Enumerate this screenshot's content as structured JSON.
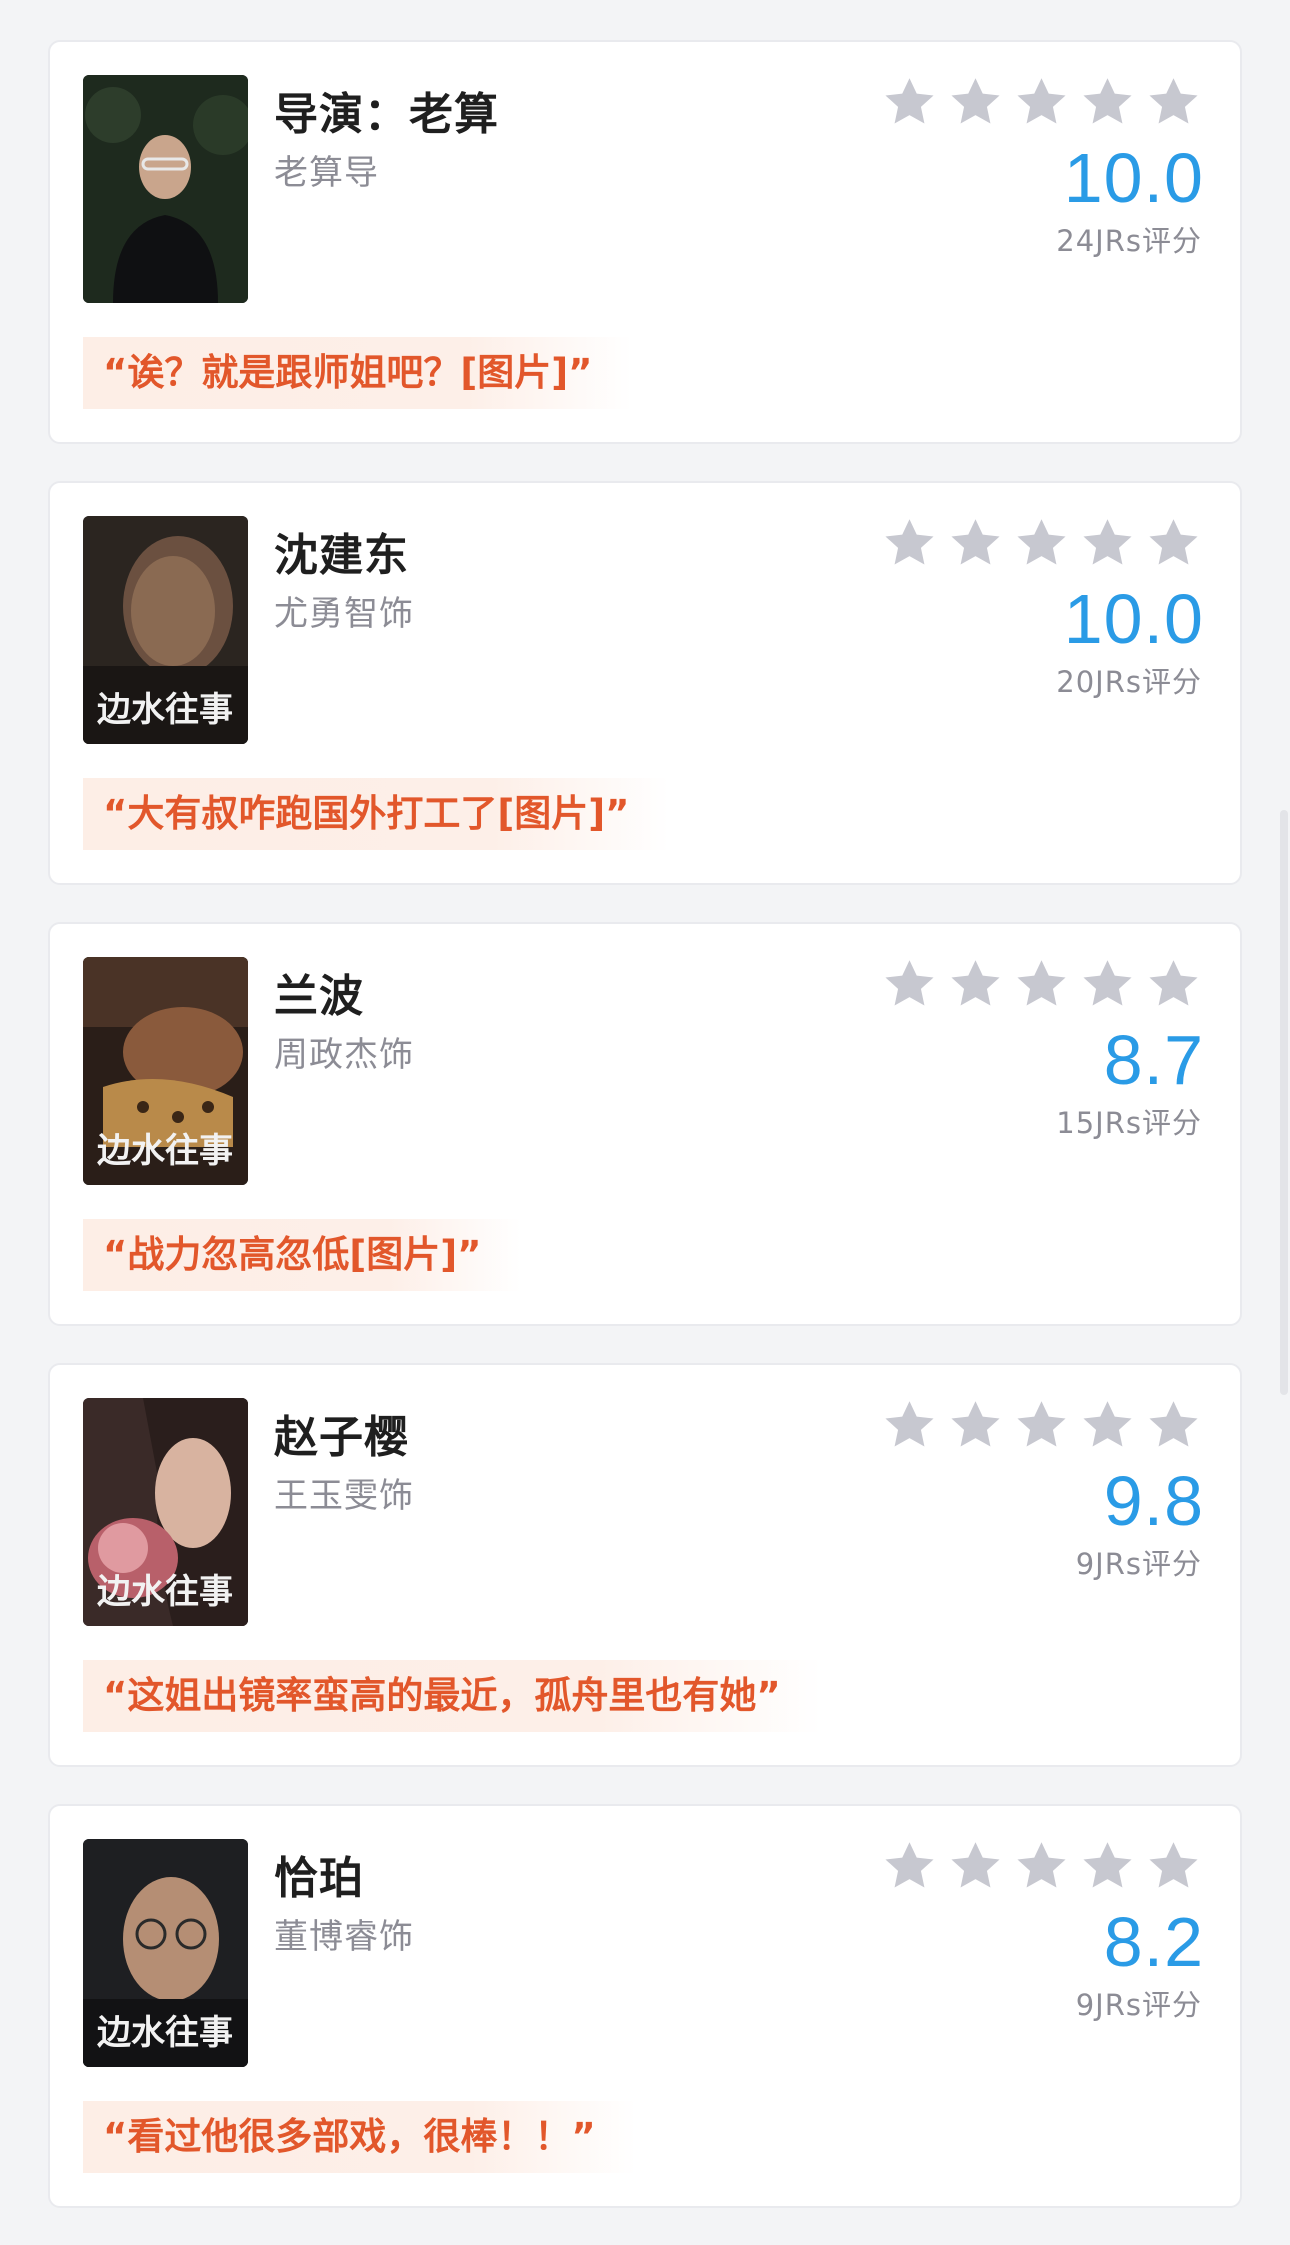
{
  "accent_color": "#2a9be6",
  "quote_color": "#e2572b",
  "star_color": "#c7c8d0",
  "poster_overlay_text": "边水往事",
  "cards": [
    {
      "name": "导演：老算",
      "role": "老算导",
      "score": "10.0",
      "count": "24JRs评分",
      "quote": "“诶？就是跟师姐吧？[图片]”",
      "poster_icon": "director-photo",
      "poster_has_logo": false
    },
    {
      "name": "沈建东",
      "role": "尤勇智饰",
      "score": "10.0",
      "count": "20JRs评分",
      "quote": "“大有叔咋跑国外打工了[图片]”",
      "poster_icon": "character-poster",
      "poster_has_logo": true
    },
    {
      "name": "兰波",
      "role": "周政杰饰",
      "score": "8.7",
      "count": "15JRs评分",
      "quote": "“战力忽高忽低[图片]”",
      "poster_icon": "character-poster",
      "poster_has_logo": true
    },
    {
      "name": "赵子樱",
      "role": "王玉雯饰",
      "score": "9.8",
      "count": "9JRs评分",
      "quote": "“这姐出镜率蛮高的最近，孤舟里也有她”",
      "poster_icon": "character-poster",
      "poster_has_logo": true
    },
    {
      "name": "恰珀",
      "role": "董博睿饰",
      "score": "8.2",
      "count": "9JRs评分",
      "quote": "“看过他很多部戏，很棒！！”",
      "poster_icon": "character-poster",
      "poster_has_logo": true
    }
  ]
}
